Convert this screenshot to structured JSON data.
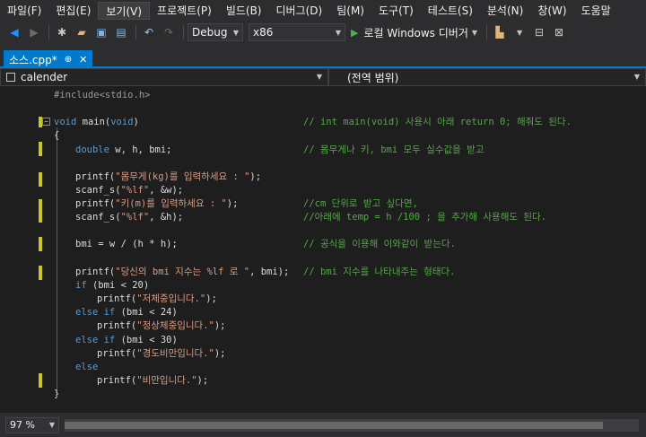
{
  "menu": [
    "파일(F)",
    "편집(E)",
    "보기(V)",
    "프로젝트(P)",
    "빌드(B)",
    "디버그(D)",
    "팀(M)",
    "도구(T)",
    "테스트(S)",
    "분석(N)",
    "창(W)",
    "도움말"
  ],
  "toolbar": {
    "config": "Debug",
    "platform": "x86",
    "run_label": "로컬 Windows 디버거"
  },
  "tab": {
    "name": "소스.cpp*",
    "pin": "⊕",
    "close": "✕"
  },
  "nav": {
    "scope": "calender",
    "member": "(전역 범위)"
  },
  "code": {
    "l1": "#include<stdio.h>",
    "l2_kw": "void",
    "l2_rest": " main(",
    "l2_kw2": "void",
    "l2_end": ")",
    "l2_cm": "// int main(void) 사용시 아래 return 0; 해줘도 된다.",
    "l3": "{",
    "l4_kw": "double",
    "l4_rest": " w, h, bmi;",
    "l4_cm": "// 몸무게나 키, bmi 모두 실수값을 받고",
    "l5_a": "printf(",
    "l5_s": "\"몸무게(kg)를 입력하세요 : \"",
    "l5_b": ");",
    "l6_a": "scanf_s(",
    "l6_s": "\"%lf\"",
    "l6_b": ", &w);",
    "l7_a": "printf(",
    "l7_s": "\"키(m)를 입력하세요 : \"",
    "l7_b": ");",
    "l7_cm": "//cm 단위로 받고 싶다면,",
    "l8_a": "scanf_s(",
    "l8_s": "\"%lf\"",
    "l8_b": ", &h);",
    "l8_cm": "//아래에 temp = h /100 ; 을 추가해 사용해도 된다.",
    "l9": "bmi = w / (h * h);",
    "l9_cm": "// 공식을 이용해 이와같이 받는다.",
    "l10_a": "printf(",
    "l10_s": "\"당신의 bmi 지수는 %lf 로 \"",
    "l10_b": ", bmi);",
    "l10_cm": "// bmi 지수를 나타내주는 형태다.",
    "l11_kw": "if",
    "l11_rest": " (bmi < 20)",
    "l12_a": "printf(",
    "l12_s": "\"저체중입니다.\"",
    "l12_b": ");",
    "l13_kw": "else if",
    "l13_rest": " (bmi < 24)",
    "l14_a": "printf(",
    "l14_s": "\"정상체중입니다.\"",
    "l14_b": ");",
    "l15_kw": "else if",
    "l15_rest": " (bmi < 30)",
    "l16_a": "printf(",
    "l16_s": "\"경도비만입니다.\"",
    "l16_b": ");",
    "l17_kw": "else",
    "l18_a": "printf(",
    "l18_s": "\"비만입니다.\"",
    "l18_b": ");",
    "l19": "}"
  },
  "status": {
    "zoom": "97 %"
  },
  "colors": {
    "accent": "#007acc",
    "keyword": "#569cd6",
    "string": "#d69d85",
    "comment": "#57a64a",
    "change_marker": "#c7c72b"
  }
}
